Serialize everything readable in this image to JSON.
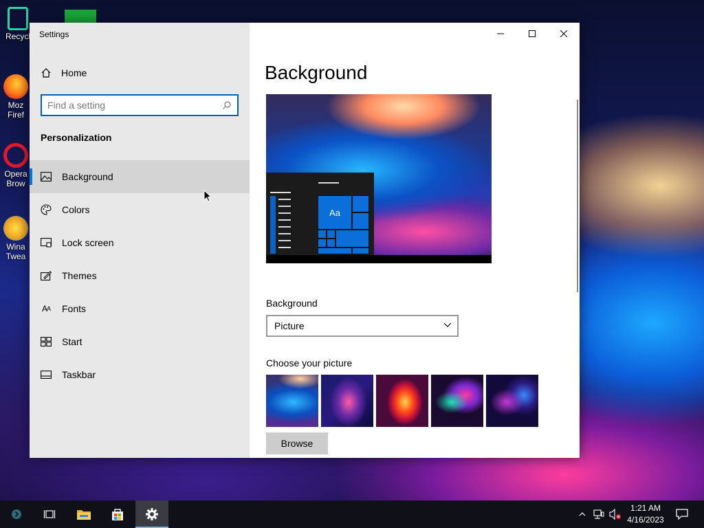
{
  "desktop": {
    "icons": [
      {
        "label": "Recycl",
        "icon": "recycle-bin-icon"
      },
      {
        "label": "Moz\nFiref",
        "icon": "firefox-icon"
      },
      {
        "label": "Opera\nBrow",
        "icon": "opera-icon"
      },
      {
        "label": "Wina\nTwea",
        "icon": "winaero-icon"
      }
    ]
  },
  "window": {
    "title": "Settings",
    "controls": [
      "minimize-icon",
      "maximize-icon",
      "close-icon"
    ]
  },
  "sidebar": {
    "home_label": "Home",
    "search_placeholder": "Find a setting",
    "section_title": "Personalization",
    "items": [
      {
        "label": "Background",
        "icon": "picture-icon",
        "active": true
      },
      {
        "label": "Colors",
        "icon": "palette-icon",
        "active": false
      },
      {
        "label": "Lock screen",
        "icon": "lock-screen-icon",
        "active": false
      },
      {
        "label": "Themes",
        "icon": "themes-icon",
        "active": false
      },
      {
        "label": "Fonts",
        "icon": "fonts-icon",
        "active": false
      },
      {
        "label": "Start",
        "icon": "start-icon",
        "active": false
      },
      {
        "label": "Taskbar",
        "icon": "taskbar-icon",
        "active": false
      }
    ]
  },
  "main": {
    "title": "Background",
    "preview_tile_text": "Aa",
    "background_label": "Background",
    "background_value": "Picture",
    "choose_label": "Choose your picture",
    "browse_label": "Browse"
  },
  "taskbar": {
    "time": "1:21 AM",
    "date": "4/16/2023",
    "accent": "#76b9ed"
  }
}
